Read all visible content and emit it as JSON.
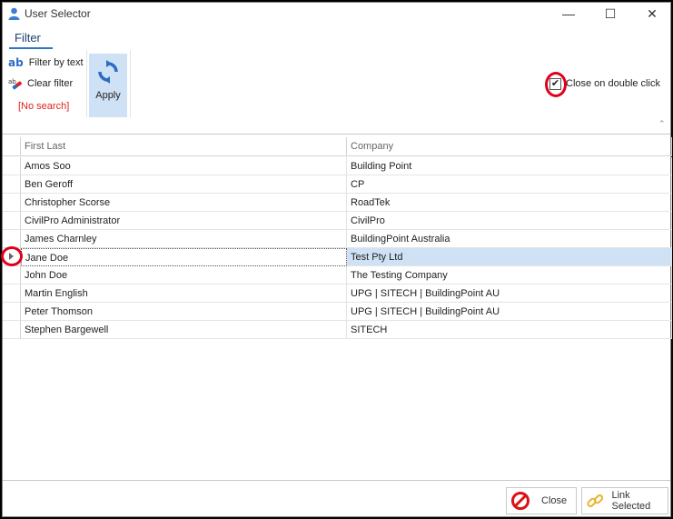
{
  "window": {
    "title": "User Selector",
    "icon": "user-icon",
    "controls": {
      "minimize": "—",
      "maximize": "☐",
      "close": "✕"
    }
  },
  "ribbon": {
    "tab_label": "Filter",
    "filter_by_text_icon": "ab",
    "filter_by_text": "Filter by text",
    "clear_filter": "Clear filter",
    "no_search": "[No search]",
    "apply_label": "Apply",
    "close_on_double_click": "Close on double click",
    "close_on_double_click_checked": true,
    "check_glyph": "✔"
  },
  "grid": {
    "columns": [
      "First Last",
      "Company"
    ],
    "rows": [
      {
        "name": "Amos Soo",
        "company": "Building Point"
      },
      {
        "name": "Ben  Geroff",
        "company": "CP"
      },
      {
        "name": "Christopher Scorse",
        "company": "RoadTek"
      },
      {
        "name": "CivilPro Administrator",
        "company": "CivilPro"
      },
      {
        "name": "James Charnley",
        "company": "BuildingPoint Australia"
      },
      {
        "name": "Jane Doe",
        "company": "Test Pty Ltd"
      },
      {
        "name": "John  Doe",
        "company": "The Testing Company"
      },
      {
        "name": "Martin English",
        "company": "UPG | SITECH | BuildingPoint AU"
      },
      {
        "name": "Peter Thomson",
        "company": "UPG | SITECH | BuildingPoint AU"
      },
      {
        "name": "Stephen Bargewell",
        "company": "SITECH"
      }
    ],
    "selected_index": 5
  },
  "footer": {
    "close_label": "Close",
    "link_selected_label": "Link Selected"
  },
  "colors": {
    "accent": "#2f76c6",
    "selection": "#cfe2f5",
    "annotation": "#e0001b",
    "no_search": "#e0221d"
  }
}
